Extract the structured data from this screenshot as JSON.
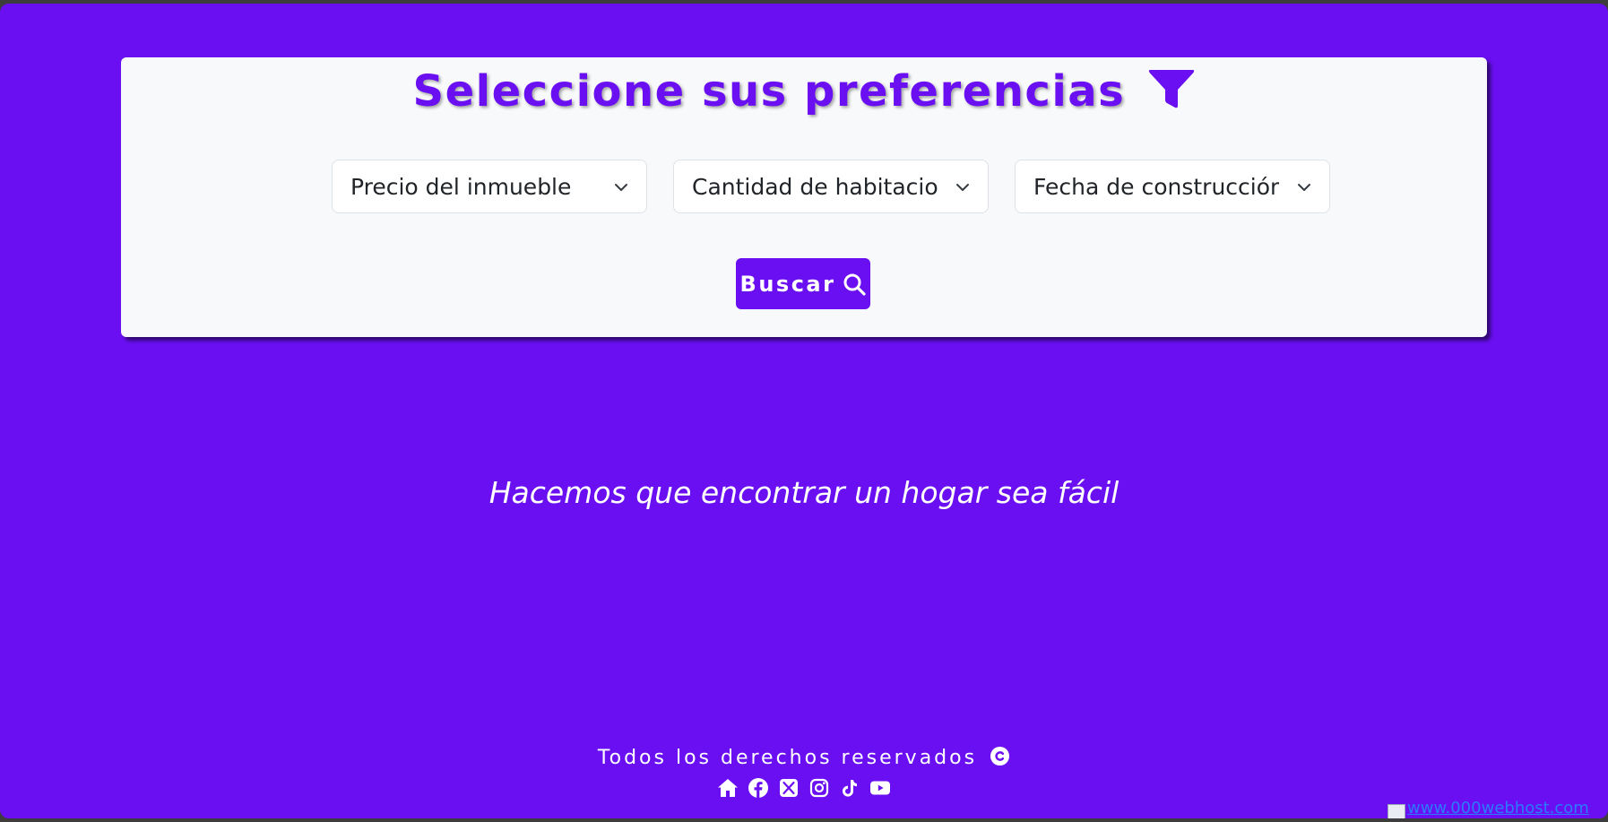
{
  "colors": {
    "primary": "#6a0ff2",
    "card_background": "#f8f9fa",
    "text_dark": "#212529",
    "white": "#ffffff",
    "link": "#2b7bff"
  },
  "filter_card": {
    "title": "Seleccione sus preferencias",
    "title_icon": "filter-icon",
    "selects": [
      {
        "selected": "Precio del inmueble",
        "icon": "chevron-down-icon"
      },
      {
        "selected": "Cantidad de habitaciones",
        "icon": "chevron-down-icon"
      },
      {
        "selected": "Fecha de construcción",
        "icon": "chevron-down-icon"
      }
    ],
    "search_button": {
      "label": "Buscar",
      "icon": "search-icon"
    }
  },
  "tagline": "Hacemos que encontrar un hogar sea fácil",
  "footer": {
    "rights_text": "Todos los derechos reservados",
    "rights_icon": "copyright-icon",
    "social_icons": [
      "home-icon",
      "facebook-icon",
      "x-twitter-icon",
      "instagram-icon",
      "tiktok-icon",
      "youtube-icon"
    ]
  },
  "badge": {
    "link_text": "www.000webhost.com"
  }
}
